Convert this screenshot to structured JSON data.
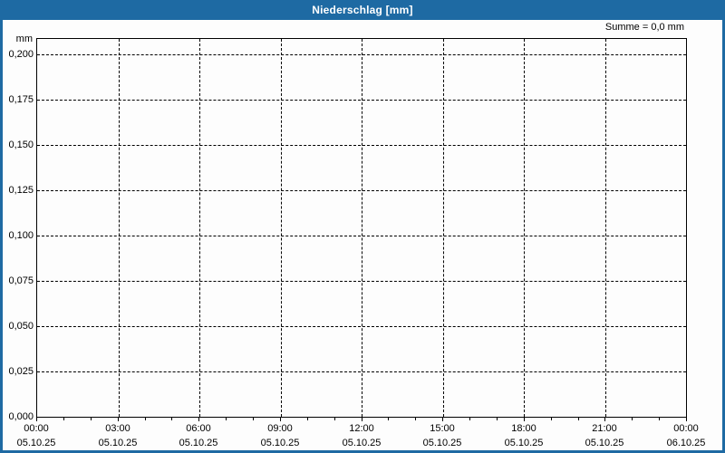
{
  "window": {
    "title": "Niederschlag [mm]"
  },
  "annotations": {
    "sum": "Summe = 0,0 mm"
  },
  "colors": {
    "frame_blue": "#1e6aa3",
    "title_text": "#ffffff",
    "plot_background": "#fdfdfd",
    "grid": "#000000",
    "text": "#000000"
  },
  "chart_data": {
    "type": "bar",
    "title": "Niederschlag [mm]",
    "ylabel": "mm",
    "xlabel": "",
    "ylim": [
      0.0,
      0.209
    ],
    "grid": "dashed",
    "legend": "none",
    "sum_annotation": "Summe = 0,0 mm",
    "sum_value_mm": 0.0,
    "series": [
      {
        "name": "Niederschlag",
        "values": []
      }
    ],
    "yticks": [
      {
        "label": "0,200",
        "value": 0.2
      },
      {
        "label": "0,175",
        "value": 0.175
      },
      {
        "label": "0,150",
        "value": 0.15
      },
      {
        "label": "0,125",
        "value": 0.125
      },
      {
        "label": "0,100",
        "value": 0.1
      },
      {
        "label": "0,075",
        "value": 0.075
      },
      {
        "label": "0,050",
        "value": 0.05
      },
      {
        "label": "0,025",
        "value": 0.025
      },
      {
        "label": "0,000",
        "value": 0.0
      }
    ],
    "xticks": [
      {
        "time": "00:00",
        "date": "05.10.25"
      },
      {
        "time": "03:00",
        "date": "05.10.25"
      },
      {
        "time": "06:00",
        "date": "05.10.25"
      },
      {
        "time": "09:00",
        "date": "05.10.25"
      },
      {
        "time": "12:00",
        "date": "05.10.25"
      },
      {
        "time": "15:00",
        "date": "05.10.25"
      },
      {
        "time": "18:00",
        "date": "05.10.25"
      },
      {
        "time": "21:00",
        "date": "05.10.25"
      },
      {
        "time": "00:00",
        "date": "06.10.25"
      }
    ],
    "minor_x_ticks_interval_hours": 1
  }
}
